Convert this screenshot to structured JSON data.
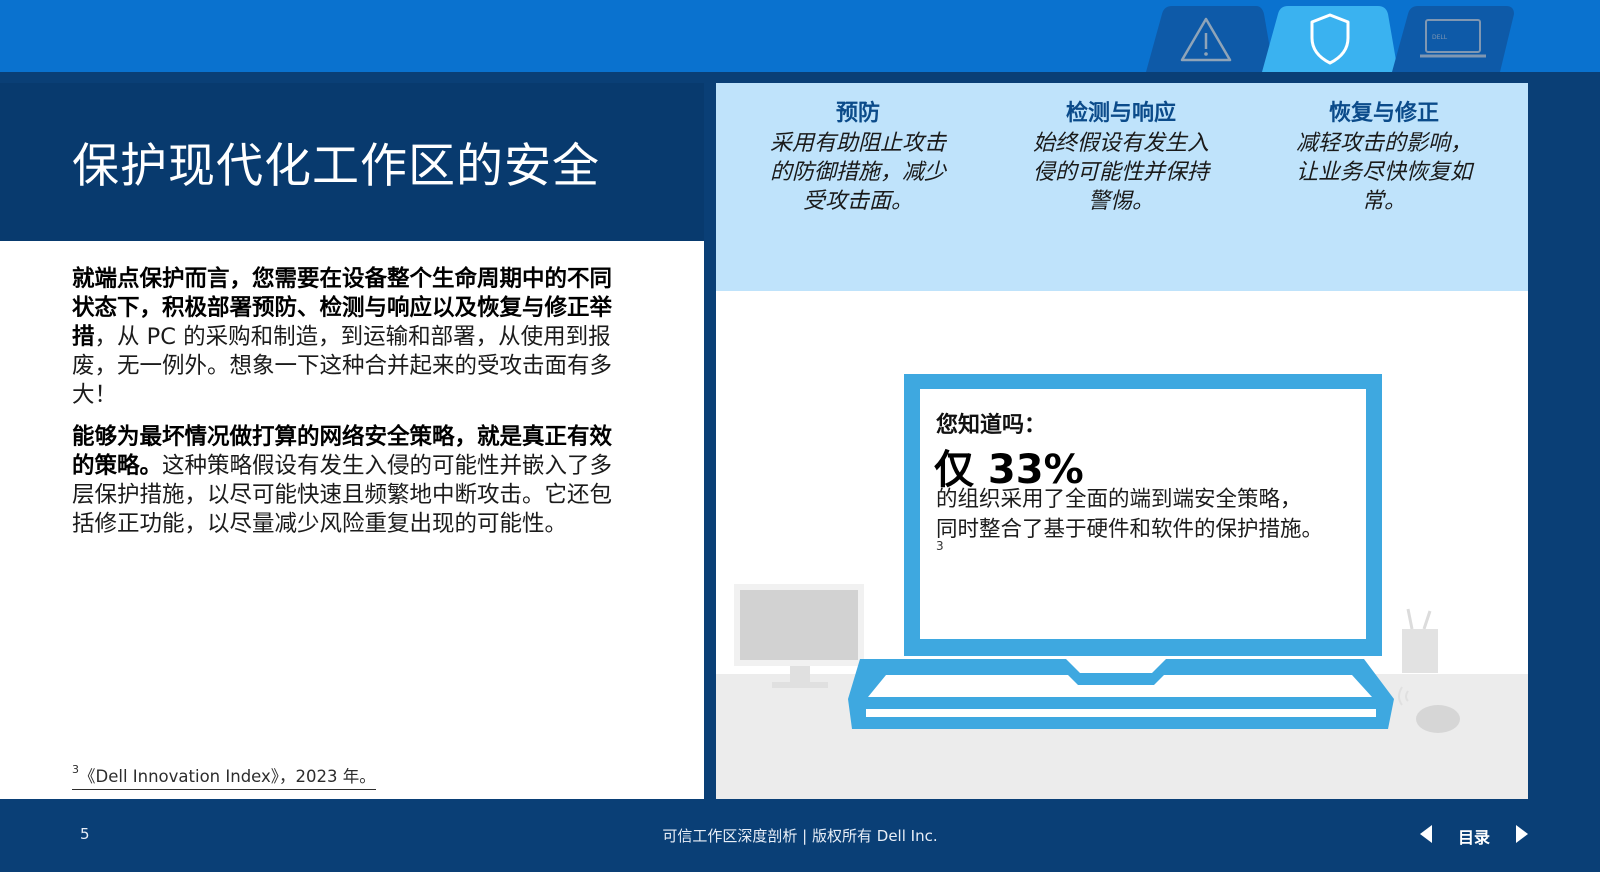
{
  "colors": {
    "top_bar": "#0a72cf",
    "dark_navy": "#083a6e",
    "footer": "#0a3f76",
    "pillar_bg": "#bfe3fb",
    "pillar_title": "#0b4b8a",
    "monitor_blue": "#3ea8e0",
    "active_tab": "#3ab2f0",
    "inactive_tab": "#0e5aa8"
  },
  "nav_tabs": [
    {
      "icon": "warning-triangle-icon",
      "active": false
    },
    {
      "icon": "shield-icon",
      "active": true
    },
    {
      "icon": "dell-laptop-icon",
      "active": false
    }
  ],
  "title": "保护现代化工作区的安全",
  "para1": {
    "bold": "就端点保护而言，您需要在设备整个生命周期中的不同状态下，积极部署预防、检测与响应以及恢复与修正举措",
    "normal": "，从 PC 的采购和制造，到运输和部署，从使用到报废，无一例外。想象一下这种合并起来的受攻击面有多大！"
  },
  "para2": {
    "bold": "能够为最坏情况做打算的网络安全策略，就是真正有效的策略。",
    "normal": "这种策略假设有发生入侵的可能性并嵌入了多层保护措施，以尽可能快速且频繁地中断攻击。它还包括修正功能，以尽量减少风险重复出现的可能性。"
  },
  "footnote": {
    "mark": "3",
    "text": "《Dell Innovation Index》，2023 年。"
  },
  "pillars": [
    {
      "title": "预防",
      "text": "采用有助阻止攻击的防御措施，减少受攻击面。"
    },
    {
      "title": "检测与响应",
      "text": "始终假设有发生入侵的可能性并保持警惕。"
    },
    {
      "title": "恢复与修正",
      "text": "减轻攻击的影响，让业务尽快恢复如常。"
    }
  ],
  "stat_card": {
    "label": "您知道吗：",
    "stat": "仅 33%",
    "desc_line1": "的组织采用了全面的端到端安全策略，",
    "desc_line2": "同时整合了基于硬件和软件的保护措施。",
    "ref": "3"
  },
  "footer": {
    "page_number": "5",
    "center_text": "可信工作区深度剖析 | 版权所有 Dell Inc.",
    "toc_label": "目录"
  }
}
